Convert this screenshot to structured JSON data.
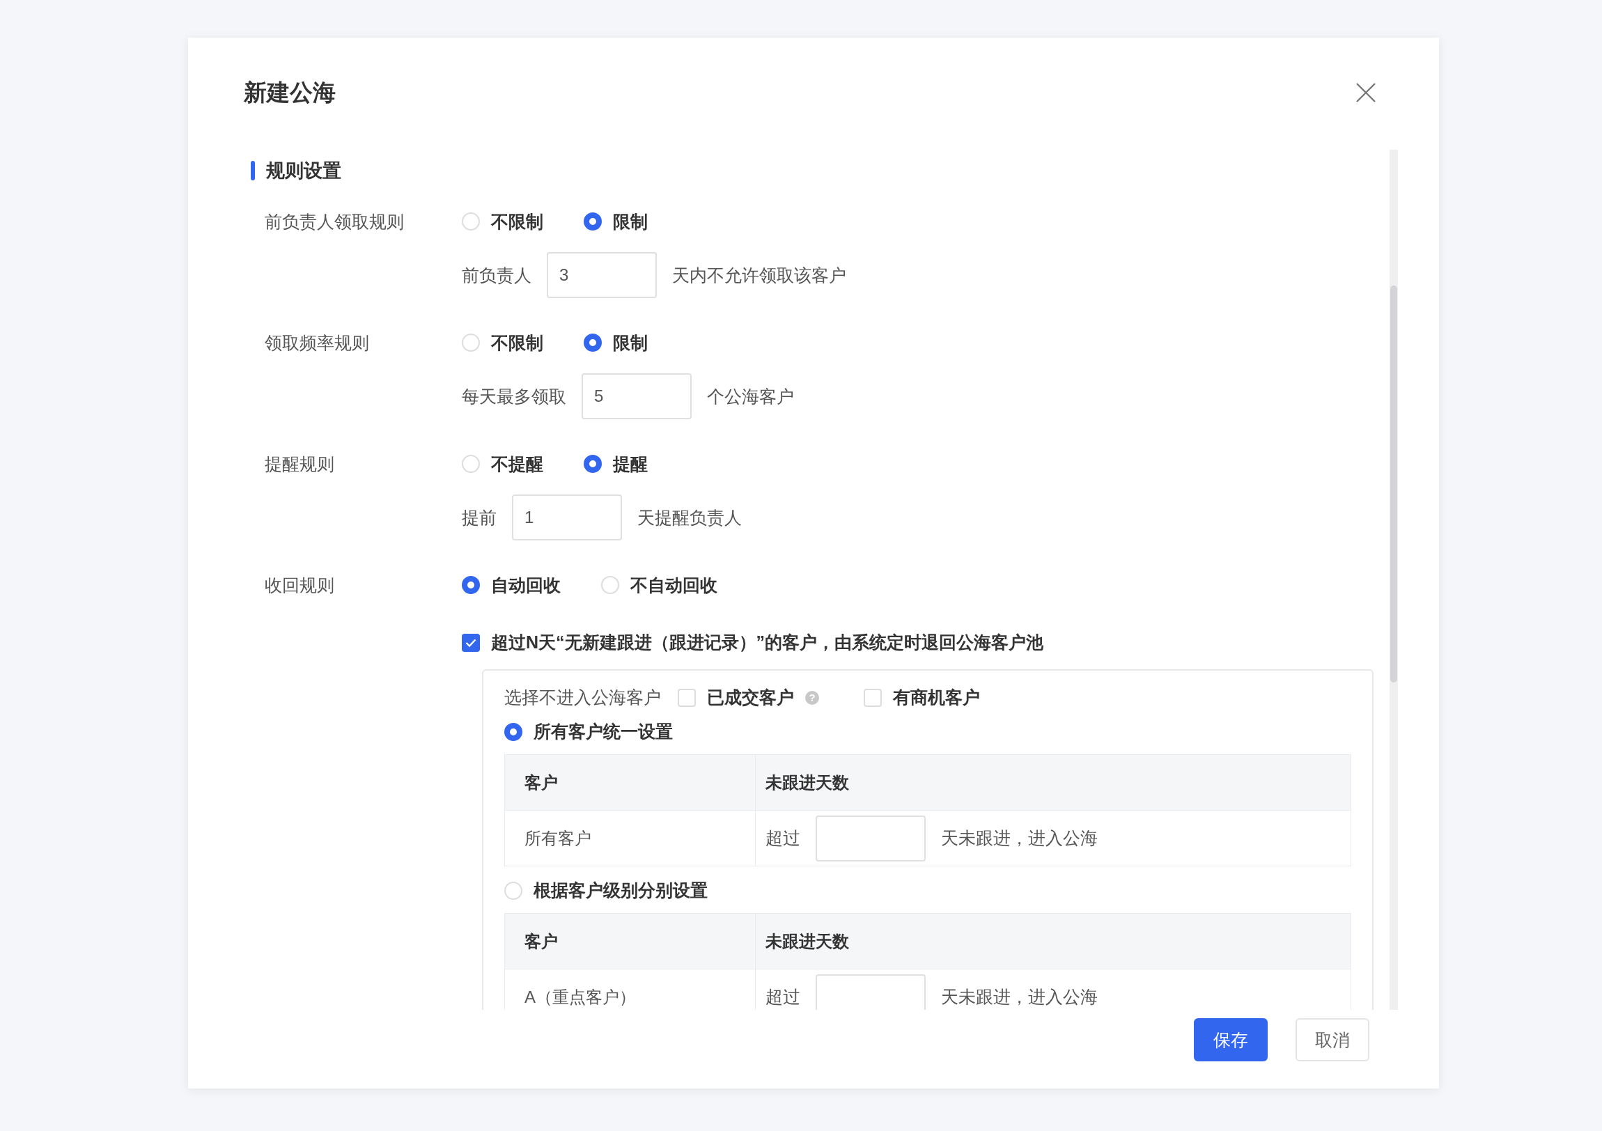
{
  "dialog": {
    "title": "新建公海"
  },
  "section": {
    "title": "规则设置"
  },
  "rules": [
    {
      "label": "前负责人领取规则",
      "options": [
        {
          "label": "不限制",
          "selected": false
        },
        {
          "label": "限制",
          "selected": true
        }
      ],
      "detail": {
        "prefix": "前负责人",
        "value": "3",
        "suffix": "天内不允许领取该客户"
      }
    },
    {
      "label": "领取频率规则",
      "options": [
        {
          "label": "不限制",
          "selected": false
        },
        {
          "label": "限制",
          "selected": true
        }
      ],
      "detail": {
        "prefix": "每天最多领取",
        "value": "5",
        "suffix": "个公海客户"
      }
    },
    {
      "label": "提醒规则",
      "options": [
        {
          "label": "不提醒",
          "selected": false
        },
        {
          "label": "提醒",
          "selected": true
        }
      ],
      "detail": {
        "prefix": "提前",
        "value": "1",
        "suffix": "天提醒负责人"
      }
    },
    {
      "label": "收回规则",
      "options": [
        {
          "label": "自动回收",
          "selected": true
        },
        {
          "label": "不自动回收",
          "selected": false
        }
      ]
    }
  ],
  "auto_recycle": {
    "checked": true,
    "text": "超过N天“无新建跟进（跟进记录）”的客户，由系统定时退回公海客户池"
  },
  "exclude": {
    "label": "选择不进入公海客户",
    "options": [
      {
        "label": "已成交客户",
        "checked": false,
        "help": "?"
      },
      {
        "label": "有商机客户",
        "checked": false
      }
    ]
  },
  "modes": [
    {
      "label": "所有客户统一设置",
      "selected": true,
      "table": {
        "columns": [
          "客户",
          "未跟进天数"
        ],
        "rows": [
          {
            "customer": "所有客户",
            "before": "超过",
            "after": "天未跟进，进入公海"
          }
        ]
      }
    },
    {
      "label": "根据客户级别分别设置",
      "selected": false,
      "table": {
        "columns": [
          "客户",
          "未跟进天数"
        ],
        "rows": [
          {
            "customer": "A（重点客户）",
            "before": "超过",
            "after": "天未跟进，进入公海"
          }
        ]
      }
    }
  ],
  "buttons": [
    {
      "label": "保存",
      "kind": "primary"
    },
    {
      "label": "取消",
      "kind": "default"
    }
  ]
}
